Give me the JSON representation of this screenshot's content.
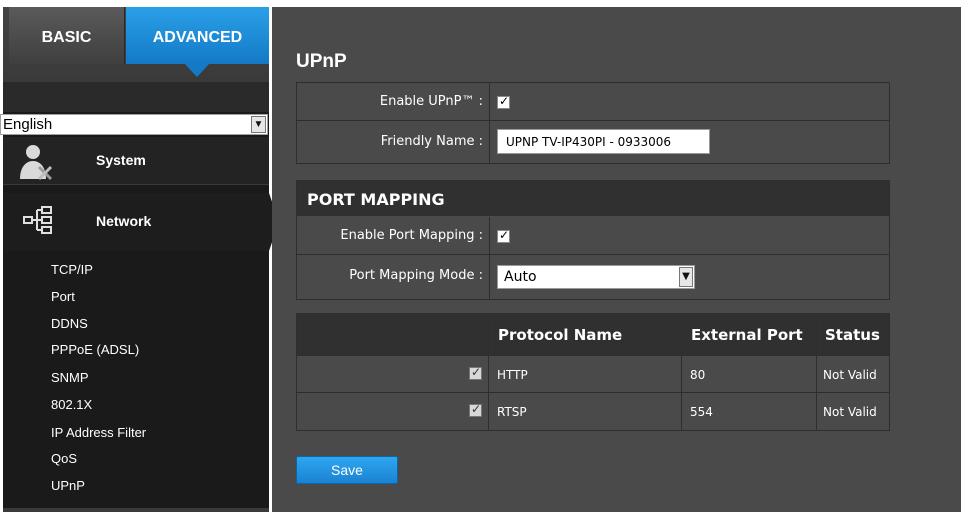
{
  "tabs": {
    "basic": "BASIC",
    "advanced": "ADVANCED"
  },
  "language": {
    "selected": "English"
  },
  "sidebar": {
    "categories": [
      {
        "label": "System",
        "icon": "system-tools-icon"
      },
      {
        "label": "Network",
        "icon": "network-tree-icon"
      }
    ],
    "network_items": [
      "TCP/IP",
      "Port",
      "DDNS",
      "PPPoE (ADSL)",
      "SNMP",
      "802.1X",
      "IP Address Filter",
      "QoS",
      "UPnP"
    ]
  },
  "page": {
    "title": "UPnP"
  },
  "upnp": {
    "enable_label": "Enable UPnP™ :",
    "enable_checked": true,
    "friendly_name_label": "Friendly Name :",
    "friendly_name_value": "UPNP TV-IP430PI - 0933006"
  },
  "port_mapping": {
    "title": "PORT MAPPING",
    "enable_label": "Enable Port Mapping :",
    "enable_checked": true,
    "mode_label": "Port Mapping Mode :",
    "mode_value": "Auto"
  },
  "table": {
    "headers": [
      "",
      "Protocol Name",
      "External Port",
      "Status"
    ],
    "rows": [
      {
        "checked": true,
        "protocol": "HTTP",
        "port": "80",
        "status": "Not Valid"
      },
      {
        "checked": true,
        "protocol": "RTSP",
        "port": "554",
        "status": "Not Valid"
      }
    ]
  },
  "actions": {
    "save": "Save"
  },
  "colors": {
    "accent": "#1a82d2",
    "sidebar_bg": "#1a1a1a",
    "main_bg": "#4a4a4a"
  }
}
